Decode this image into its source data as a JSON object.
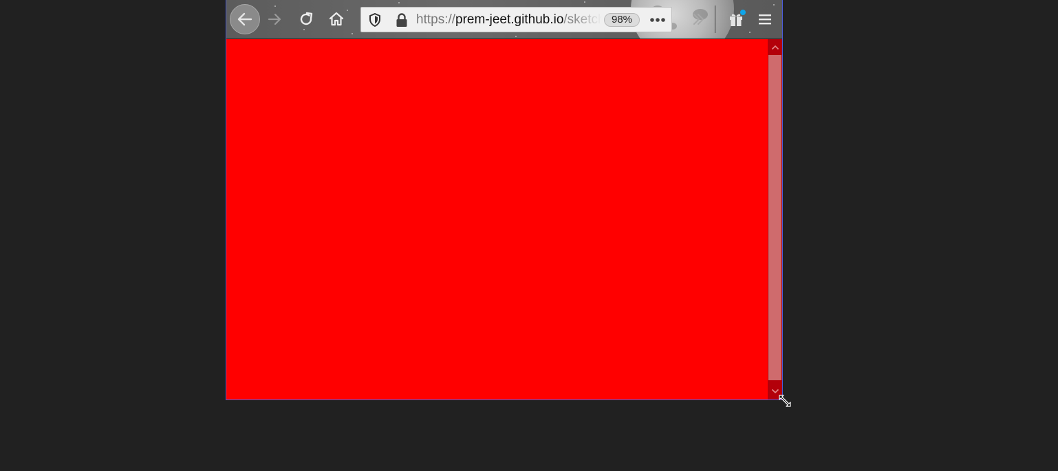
{
  "browser": {
    "url": {
      "scheme": "https://",
      "host": "prem-jeet.github.io",
      "path": "/sketch"
    },
    "zoom_level": "98%"
  },
  "toolbar": {
    "icons": [
      "back-icon",
      "forward-icon",
      "reload-icon",
      "home-icon",
      "shield-icon",
      "lock-icon",
      "more-actions-icon",
      "chevron-right-icon",
      "gift-icon",
      "hamburger-menu-icon"
    ]
  },
  "page": {
    "background_color": "#ff0000"
  },
  "scrollbar": {
    "track_color": "#b3000a",
    "thumb_color": "#cf6b6d"
  },
  "colors": {
    "desktop_background": "#212121",
    "window_border": "#4a5ad8",
    "notification_dot": "#0ea5e9"
  }
}
